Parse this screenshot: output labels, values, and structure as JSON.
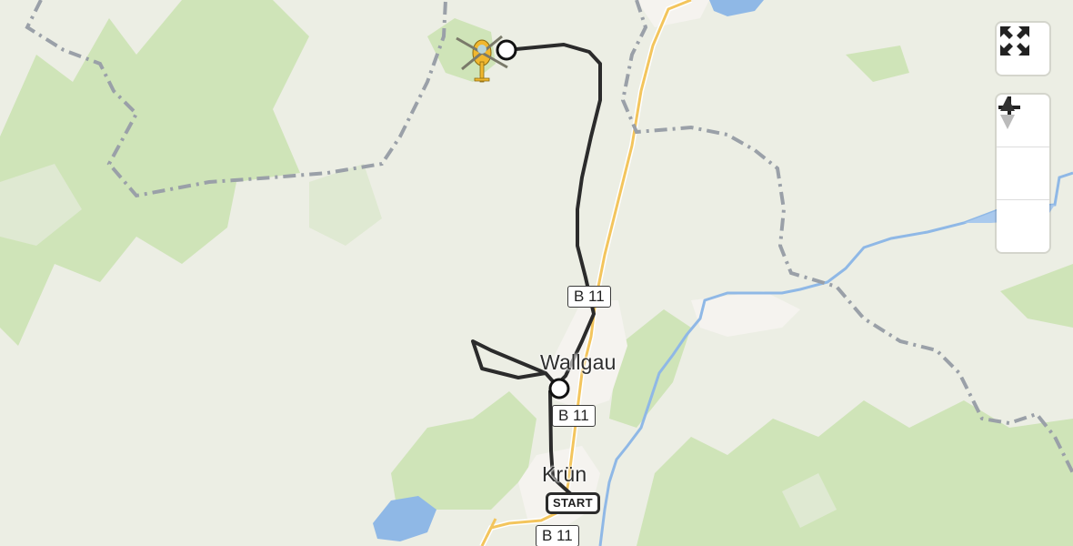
{
  "map": {
    "places": [
      {
        "id": "wallgau",
        "name": "Wallgau"
      },
      {
        "id": "kruen",
        "name": "Krün"
      }
    ],
    "road_shields": [
      "B 11",
      "B 11",
      "B 11"
    ],
    "route": {
      "start_label": "START",
      "colors": {
        "route": "#2b2b2b",
        "waypoint_fill": "#ffffff"
      }
    },
    "icons": {
      "helicopter": "helicopter-icon",
      "fullscreen": "fullscreen-icon",
      "zoom_in": "plus-icon",
      "zoom_out": "minus-icon",
      "compass": "compass-icon"
    },
    "colors": {
      "land": "#eceee4",
      "forest": "#c8e0b0",
      "water": "#8fb8e6",
      "highway": "#f3c55d",
      "border": "#9aa0a8"
    }
  }
}
